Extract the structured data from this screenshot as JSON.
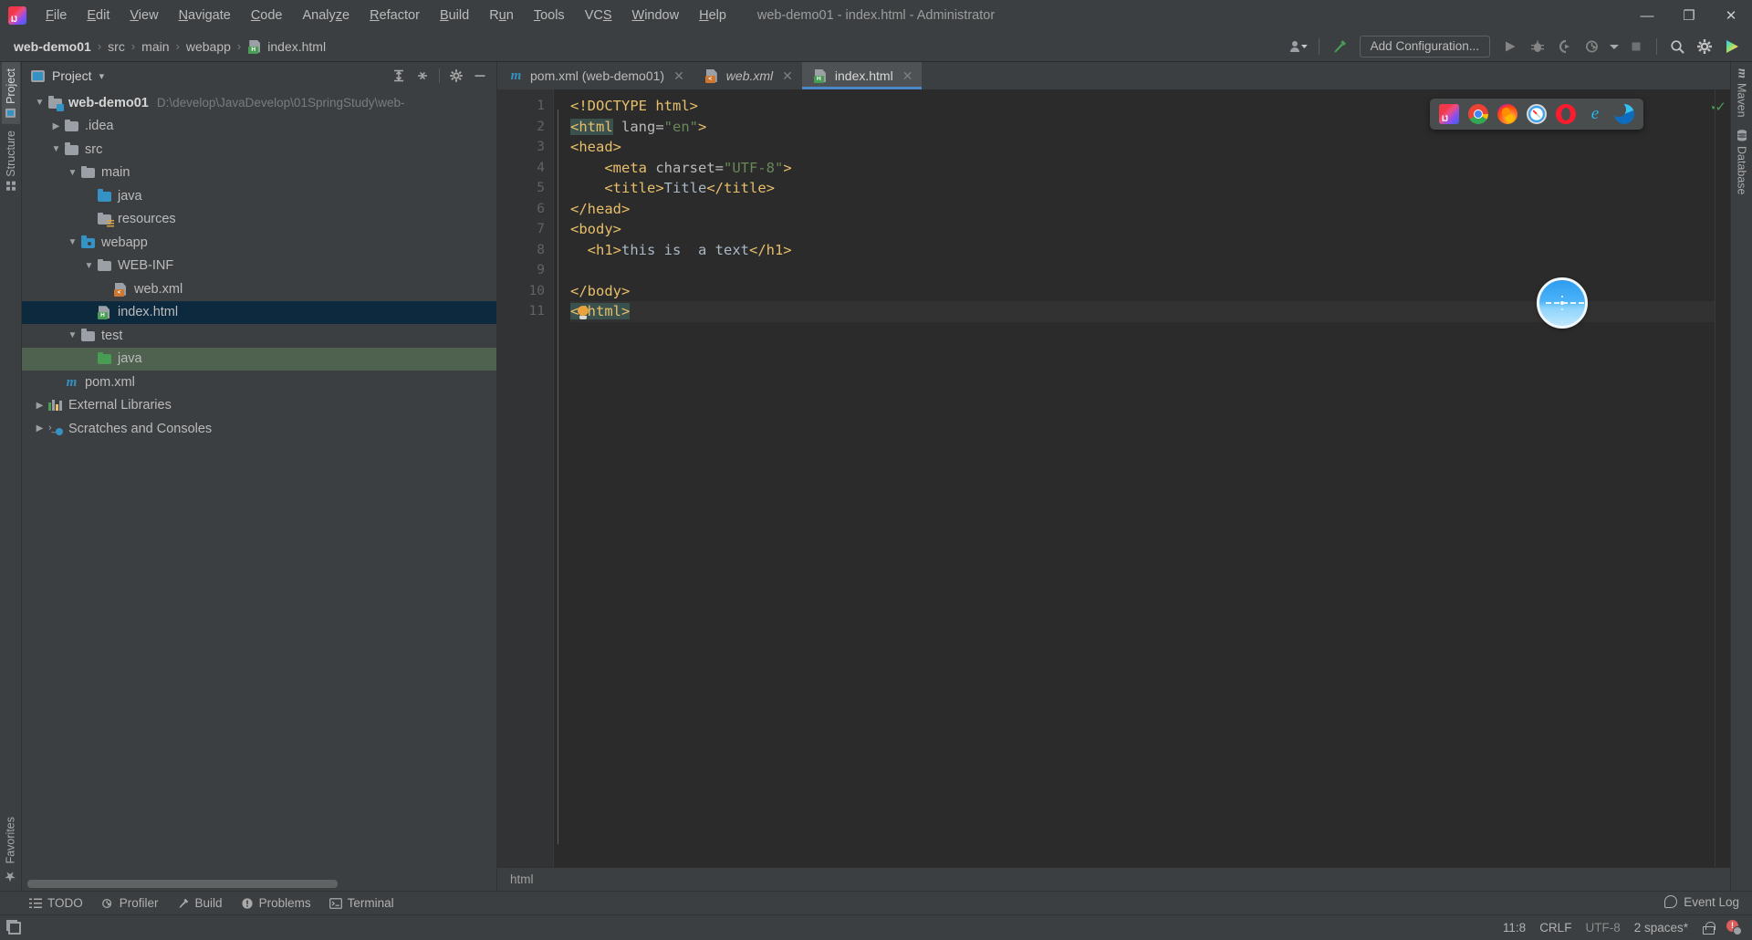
{
  "window": {
    "title": "web-demo01 - index.html - Administrator",
    "minimize": "—",
    "maximize": "❐",
    "close": "✕"
  },
  "menu": {
    "items": [
      {
        "label": "File",
        "mnemonic": "F"
      },
      {
        "label": "Edit",
        "mnemonic": "E"
      },
      {
        "label": "View",
        "mnemonic": "V"
      },
      {
        "label": "Navigate",
        "mnemonic": "N"
      },
      {
        "label": "Code",
        "mnemonic": "C"
      },
      {
        "label": "Analyze",
        "mnemonic": "z"
      },
      {
        "label": "Refactor",
        "mnemonic": "R"
      },
      {
        "label": "Build",
        "mnemonic": "B"
      },
      {
        "label": "Run",
        "mnemonic": "u"
      },
      {
        "label": "Tools",
        "mnemonic": "T"
      },
      {
        "label": "VCS",
        "mnemonic": "S"
      },
      {
        "label": "Window",
        "mnemonic": "W"
      },
      {
        "label": "Help",
        "mnemonic": "H"
      }
    ]
  },
  "navbar": {
    "crumbs": [
      {
        "label": "web-demo01",
        "bold": true
      },
      {
        "label": "src",
        "bold": false
      },
      {
        "label": "main",
        "bold": false
      },
      {
        "label": "webapp",
        "bold": false
      },
      {
        "label": "index.html",
        "bold": false,
        "icon": "html-file-icon"
      }
    ],
    "separator": "›",
    "add_configuration": "Add Configuration...",
    "icons": [
      "user-dropdown-icon",
      "hammer-build-icon",
      "run-icon",
      "debug-icon",
      "run-coverage-icon",
      "profile-icon",
      "profile-dropdown-icon",
      "stop-icon",
      "search-everywhere-icon",
      "settings-gear-icon",
      "ide-assistant-icon"
    ]
  },
  "left_stripe": {
    "items": [
      {
        "label": "Project",
        "icon": "project-icon",
        "active": true
      },
      {
        "label": "Structure",
        "icon": "structure-icon",
        "active": false
      }
    ],
    "bottom": [
      {
        "label": "Favorites",
        "icon": "star-icon",
        "active": false
      }
    ]
  },
  "right_stripe": {
    "items": [
      {
        "label": "Maven",
        "icon": "maven-icon"
      },
      {
        "label": "Database",
        "icon": "database-icon"
      }
    ]
  },
  "project_panel": {
    "title": "Project",
    "dropdown": "▾",
    "toolbar_icons": [
      "expand-all-icon",
      "collapse-all-icon",
      "settings-gear-icon",
      "hide-icon"
    ],
    "tree": [
      {
        "label": "web-demo01",
        "path": "D:\\develop\\JavaDevelop\\01SpringStudy\\web-",
        "indent": 0,
        "chevron": "down",
        "icon": "module-folder-icon",
        "bold": true,
        "state": "none"
      },
      {
        "label": ".idea",
        "indent": 1,
        "chevron": "right",
        "icon": "folder-icon",
        "state": "none"
      },
      {
        "label": "src",
        "indent": 1,
        "chevron": "down",
        "icon": "folder-icon",
        "state": "none"
      },
      {
        "label": "main",
        "indent": 2,
        "chevron": "down",
        "icon": "folder-icon",
        "state": "none"
      },
      {
        "label": "java",
        "indent": 3,
        "chevron": "none",
        "icon": "source-folder-icon",
        "state": "none"
      },
      {
        "label": "resources",
        "indent": 3,
        "chevron": "none",
        "icon": "resources-folder-icon",
        "state": "none"
      },
      {
        "label": "webapp",
        "indent": 2,
        "chevron": "down",
        "icon": "webapp-folder-icon",
        "state": "none"
      },
      {
        "label": "WEB-INF",
        "indent": 3,
        "chevron": "down",
        "icon": "folder-icon",
        "state": "none"
      },
      {
        "label": "web.xml",
        "indent": 4,
        "chevron": "none",
        "icon": "xml-file-icon",
        "state": "none"
      },
      {
        "label": "index.html",
        "indent": 3,
        "chevron": "none",
        "icon": "html-file-icon",
        "state": "selected"
      },
      {
        "label": "test",
        "indent": 2,
        "chevron": "down",
        "icon": "folder-icon",
        "state": "none"
      },
      {
        "label": "java",
        "indent": 3,
        "chevron": "none",
        "icon": "test-source-folder-icon",
        "state": "highlighted"
      },
      {
        "label": "pom.xml",
        "indent": 1,
        "chevron": "none",
        "icon": "maven-pom-icon",
        "state": "none"
      },
      {
        "label": "External Libraries",
        "indent": 0,
        "chevron": "right",
        "icon": "libraries-icon",
        "state": "none"
      },
      {
        "label": "Scratches and Consoles",
        "indent": 0,
        "chevron": "right",
        "icon": "scratches-icon",
        "state": "none"
      }
    ]
  },
  "editor": {
    "tabs": [
      {
        "label": "pom.xml (web-demo01)",
        "icon": "maven-pom-icon",
        "active": false,
        "italic": false,
        "close": "✕"
      },
      {
        "label": "web.xml",
        "icon": "xml-file-icon",
        "active": false,
        "italic": true,
        "close": "✕"
      },
      {
        "label": "index.html",
        "icon": "html-file-icon",
        "active": true,
        "italic": false,
        "close": "✕"
      }
    ],
    "line_numbers": [
      "1",
      "2",
      "3",
      "4",
      "5",
      "6",
      "7",
      "8",
      "9",
      "10",
      "11"
    ],
    "lines": [
      {
        "n": 1,
        "indent": "",
        "parts": [
          {
            "t": "<!DOCTYPE html>",
            "c": "tg"
          }
        ]
      },
      {
        "n": 2,
        "indent": "",
        "parts": [
          {
            "t": "<html",
            "c": "tg hl"
          },
          {
            "t": " lang=",
            "c": "at"
          },
          {
            "t": "\"en\"",
            "c": "st"
          },
          {
            "t": ">",
            "c": "tg"
          }
        ]
      },
      {
        "n": 3,
        "indent": "",
        "parts": [
          {
            "t": "<head>",
            "c": "tg"
          }
        ]
      },
      {
        "n": 4,
        "indent": "    ",
        "parts": [
          {
            "t": "<meta ",
            "c": "tg"
          },
          {
            "t": "charset=",
            "c": "at"
          },
          {
            "t": "\"UTF-8\"",
            "c": "st"
          },
          {
            "t": ">",
            "c": "tg"
          }
        ]
      },
      {
        "n": 5,
        "indent": "    ",
        "parts": [
          {
            "t": "<title>",
            "c": "tg"
          },
          {
            "t": "Title",
            "c": "tx"
          },
          {
            "t": "</title>",
            "c": "tg"
          }
        ]
      },
      {
        "n": 6,
        "indent": "",
        "parts": [
          {
            "t": "</head>",
            "c": "tg"
          }
        ]
      },
      {
        "n": 7,
        "indent": "",
        "parts": [
          {
            "t": "<body>",
            "c": "tg"
          }
        ]
      },
      {
        "n": 8,
        "indent": "  ",
        "parts": [
          {
            "t": "<h1>",
            "c": "tg"
          },
          {
            "t": "this is  a text",
            "c": "tx"
          },
          {
            "t": "</h1>",
            "c": "tg"
          }
        ]
      },
      {
        "n": 9,
        "indent": "",
        "parts": []
      },
      {
        "n": 10,
        "indent": "",
        "parts": [
          {
            "t": "</body>",
            "c": "tg"
          }
        ]
      },
      {
        "n": 11,
        "indent": "",
        "parts": [
          {
            "t": "</html>",
            "c": "tg hl"
          }
        ]
      }
    ],
    "breadcrumb": "html",
    "inspection_status": "✓"
  },
  "browser_popup": {
    "browsers": [
      {
        "name": "intellij-preview-icon",
        "cls": "bi-ij"
      },
      {
        "name": "chrome-icon",
        "cls": "bi-chrome"
      },
      {
        "name": "firefox-icon",
        "cls": "bi-firefox"
      },
      {
        "name": "safari-icon",
        "cls": "bi-safari"
      },
      {
        "name": "opera-icon",
        "cls": "bi-opera"
      },
      {
        "name": "internet-explorer-icon",
        "cls": "bi-ie",
        "glyph": "e"
      },
      {
        "name": "edge-icon",
        "cls": "bi-edge"
      }
    ]
  },
  "bottom_stripe": {
    "items": [
      {
        "label": "TODO",
        "icon": "todo-list-icon"
      },
      {
        "label": "Profiler",
        "icon": "profiler-icon"
      },
      {
        "label": "Build",
        "icon": "hammer-build-icon"
      },
      {
        "label": "Problems",
        "icon": "problems-warning-icon"
      },
      {
        "label": "Terminal",
        "icon": "terminal-icon"
      }
    ]
  },
  "statusbar": {
    "event_log": "Event Log",
    "caret_position": "11:8",
    "line_separator": "CRLF",
    "encoding": "UTF-8",
    "indent": "2 spaces*",
    "lock": "read-only-lock-icon",
    "notification": "notification-icon"
  }
}
